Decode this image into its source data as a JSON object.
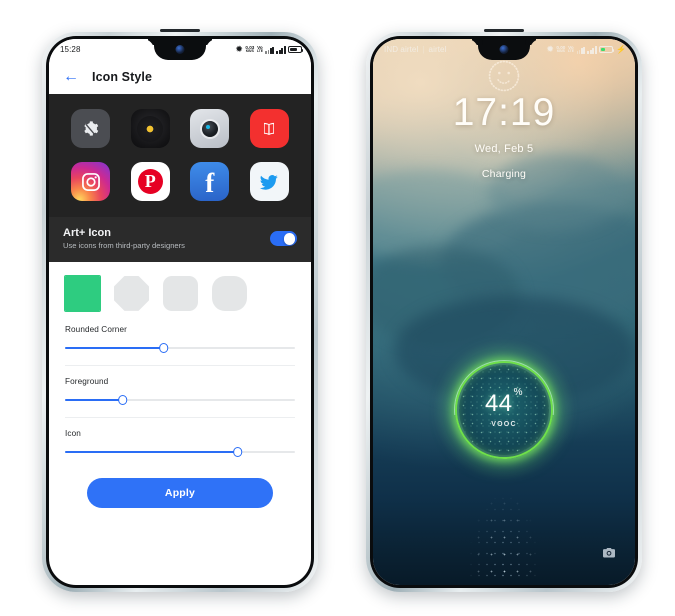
{
  "left_phone": {
    "status_bar": {
      "time": "15:28",
      "net_rate_value": "0.03",
      "net_rate_unit": "KB/S",
      "data_badge_top": "Vo",
      "data_badge_bottom": "LTE",
      "icons": [
        "bluetooth-icon",
        "network-speed-icon",
        "volte-icon",
        "signal-bars-sim1-icon",
        "signal-bars-sim2-icon",
        "battery-icon"
      ]
    },
    "header": {
      "back_label": "←",
      "title": "Icon Style"
    },
    "preview": {
      "background_color": "#232323",
      "app_icons": [
        {
          "name": "settings",
          "label": "Settings"
        },
        {
          "name": "music",
          "label": "Music"
        },
        {
          "name": "camera",
          "label": "Camera"
        },
        {
          "name": "book",
          "label": "Books"
        },
        {
          "name": "instagram",
          "label": "Instagram"
        },
        {
          "name": "pinterest",
          "label": "Pinterest",
          "glyph": "P"
        },
        {
          "name": "facebook",
          "label": "Facebook",
          "glyph": "f"
        },
        {
          "name": "twitter",
          "label": "Twitter"
        }
      ]
    },
    "art_icon_row": {
      "title": "Art+ Icon",
      "subtitle": "Use icons from third-party designers",
      "toggle_state": "on",
      "toggle_color": "#2a6df5"
    },
    "shape_swatches": {
      "selected_index": 0,
      "selected_color": "#2ecc80",
      "items": [
        {
          "name": "square-swatch",
          "selected": true
        },
        {
          "name": "octagon-swatch",
          "selected": false
        },
        {
          "name": "rounded-square-swatch",
          "selected": false
        },
        {
          "name": "squircle-swatch",
          "selected": false
        }
      ]
    },
    "sliders": [
      {
        "label": "Rounded Corner",
        "value": 43
      },
      {
        "label": "Foreground",
        "value": 25
      },
      {
        "label": "Icon",
        "value": 75
      }
    ],
    "apply_button": {
      "label": "Apply",
      "color": "#2f72f7"
    }
  },
  "right_phone": {
    "status_bar": {
      "carrier_primary": "IND airtel",
      "carrier_separator": "|",
      "carrier_secondary": "airtel",
      "net_rate_value": "0.00",
      "net_rate_unit": "KB/S",
      "data_badge_top": "Vo",
      "data_badge_bottom": "LTE",
      "icons": [
        "bluetooth-icon",
        "network-speed-icon",
        "volte-icon",
        "signal-bars-sim1-icon",
        "signal-bars-sim2-icon",
        "battery-charging-icon"
      ],
      "battery_charging_color": "#3ddc6b"
    },
    "face_unlock_icon": "face-unlock-icon",
    "lockscreen": {
      "time": "17:19",
      "date": "Wed, Feb 5",
      "status": "Charging"
    },
    "charge_ring": {
      "percent": "44",
      "percent_symbol": "%",
      "tech_label": "VOOC",
      "ring_color": "#6fe04a"
    },
    "camera_shortcut": "camera-icon"
  }
}
